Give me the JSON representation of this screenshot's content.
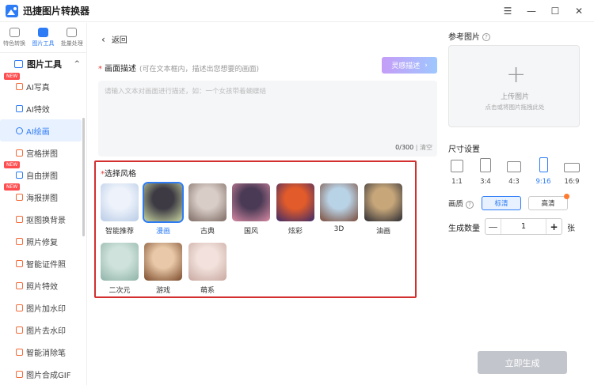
{
  "app": {
    "title": "迅捷图片转换器"
  },
  "window_controls": [
    "☰",
    "—",
    "☐",
    "✕"
  ],
  "sidebar": {
    "top_tabs": [
      {
        "label": "特色转换",
        "icon": "exchange-icon"
      },
      {
        "label": "图片工具",
        "icon": "image-tool-icon",
        "active": true
      },
      {
        "label": "批量处理",
        "icon": "batch-icon"
      }
    ],
    "section": {
      "label": "图片工具",
      "chevron": "^"
    },
    "items": [
      {
        "label": "AI写真",
        "badge": "NEW"
      },
      {
        "label": "AI特效"
      },
      {
        "label": "AI绘画",
        "active": true
      },
      {
        "label": "宫格拼图"
      },
      {
        "label": "自由拼图",
        "badge": "NEW"
      },
      {
        "label": "海报拼图",
        "badge": "NEW"
      },
      {
        "label": "抠图换背景"
      },
      {
        "label": "照片修复"
      },
      {
        "label": "智能证件照"
      },
      {
        "label": "照片特效"
      },
      {
        "label": "图片加水印"
      },
      {
        "label": "图片去水印"
      },
      {
        "label": "智能消除笔"
      },
      {
        "label": "图片合成GIF"
      }
    ]
  },
  "main": {
    "back_label": "返回",
    "description": {
      "required": "*",
      "label": "画面描述",
      "hint": "(可在文本框内，描述出您想要的画面)",
      "upgrade_label": "灵感描述",
      "placeholder": "请输入文本对画面进行描述，如：一个女孩带着蝴蝶结",
      "count": "0/300",
      "clear": "清空"
    },
    "styles": {
      "required": "*",
      "label": "选择风格",
      "items": [
        {
          "label": "智能推荐",
          "colors": [
            "#eef3fb",
            "#b8cbe6"
          ]
        },
        {
          "label": "漫画",
          "colors": [
            "#3d3a44",
            "#c9d7a0"
          ],
          "selected": true
        },
        {
          "label": "古典",
          "colors": [
            "#d9cdc7",
            "#7d6a64"
          ]
        },
        {
          "label": "国风",
          "colors": [
            "#4a3a55",
            "#d98aa4"
          ]
        },
        {
          "label": "炫彩",
          "colors": [
            "#e25b2a",
            "#3a2a6a"
          ]
        },
        {
          "label": "3D",
          "colors": [
            "#b9d3e6",
            "#7a4a38"
          ]
        },
        {
          "label": "油画",
          "colors": [
            "#c7a77a",
            "#2a2a32"
          ]
        },
        {
          "label": "二次元",
          "colors": [
            "#cfe3dc",
            "#8fb3a8"
          ]
        },
        {
          "label": "游戏",
          "colors": [
            "#e8c8a8",
            "#7a4a2a"
          ]
        },
        {
          "label": "萌系",
          "colors": [
            "#f2e1dc",
            "#c8a8a0"
          ]
        }
      ]
    }
  },
  "right_panel": {
    "reference": {
      "label": "参考图片",
      "help": "?",
      "upload_title": "上传图片",
      "upload_sub": "点击或将图片拖拽此处"
    },
    "size": {
      "label": "尺寸设置",
      "ratios": [
        {
          "label": "1:1"
        },
        {
          "label": "3:4"
        },
        {
          "label": "4:3"
        },
        {
          "label": "9:16",
          "active": true
        },
        {
          "label": "16:9"
        }
      ]
    },
    "quality": {
      "label": "画质",
      "help": "?",
      "options": [
        {
          "label": "标清",
          "active": true
        },
        {
          "label": "高清"
        }
      ]
    },
    "count": {
      "label": "生成数量",
      "minus": "—",
      "value": "1",
      "plus": "+",
      "unit": "张"
    },
    "generate_label": "立即生成"
  },
  "colors": {
    "accent": "#2d7cf6",
    "highlight_border": "#d32f2f",
    "disabled_button": "#c2c5cb"
  }
}
